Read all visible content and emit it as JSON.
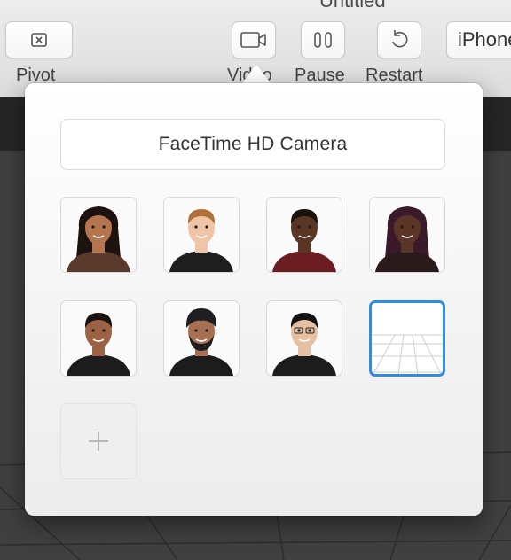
{
  "window": {
    "title": "Untitled"
  },
  "toolbar": {
    "pivot_label": "Pivot",
    "video_label": "Video",
    "pause_label": "Pause",
    "restart_label": "Restart",
    "device_label": "iPhone"
  },
  "popover": {
    "camera_source": "FaceTime HD Camera",
    "faces": [
      {
        "id": "face-1",
        "skin": "#b5764f",
        "hair": "#1c1210",
        "shirt": "#5a3a2a",
        "long_hair": true
      },
      {
        "id": "face-2",
        "skin": "#f0c4a7",
        "hair": "#b0703a",
        "shirt": "#1e1e1e",
        "long_hair": false
      },
      {
        "id": "face-3",
        "skin": "#5a3724",
        "hair": "#1a120d",
        "shirt": "#6b1d22",
        "long_hair": false
      },
      {
        "id": "face-4",
        "skin": "#5b3526",
        "hair": "#3a1a2a",
        "shirt": "#2a1a1a",
        "long_hair": true
      },
      {
        "id": "face-5",
        "skin": "#9b6244",
        "hair": "#1b1310",
        "shirt": "#1c1c1c",
        "long_hair": false
      },
      {
        "id": "face-6",
        "skin": "#a87052",
        "hair": "#1d1d1d",
        "shirt": "#1c1c1c",
        "long_hair": false,
        "turban": true,
        "beard": true
      },
      {
        "id": "face-7",
        "skin": "#e6c0a0",
        "hair": "#121212",
        "shirt": "#1c1c1c",
        "long_hair": false,
        "glasses": true
      }
    ],
    "selected_tile": "grid-plane",
    "add_icon": "plus-icon",
    "accent_color": "#2f8be3"
  }
}
